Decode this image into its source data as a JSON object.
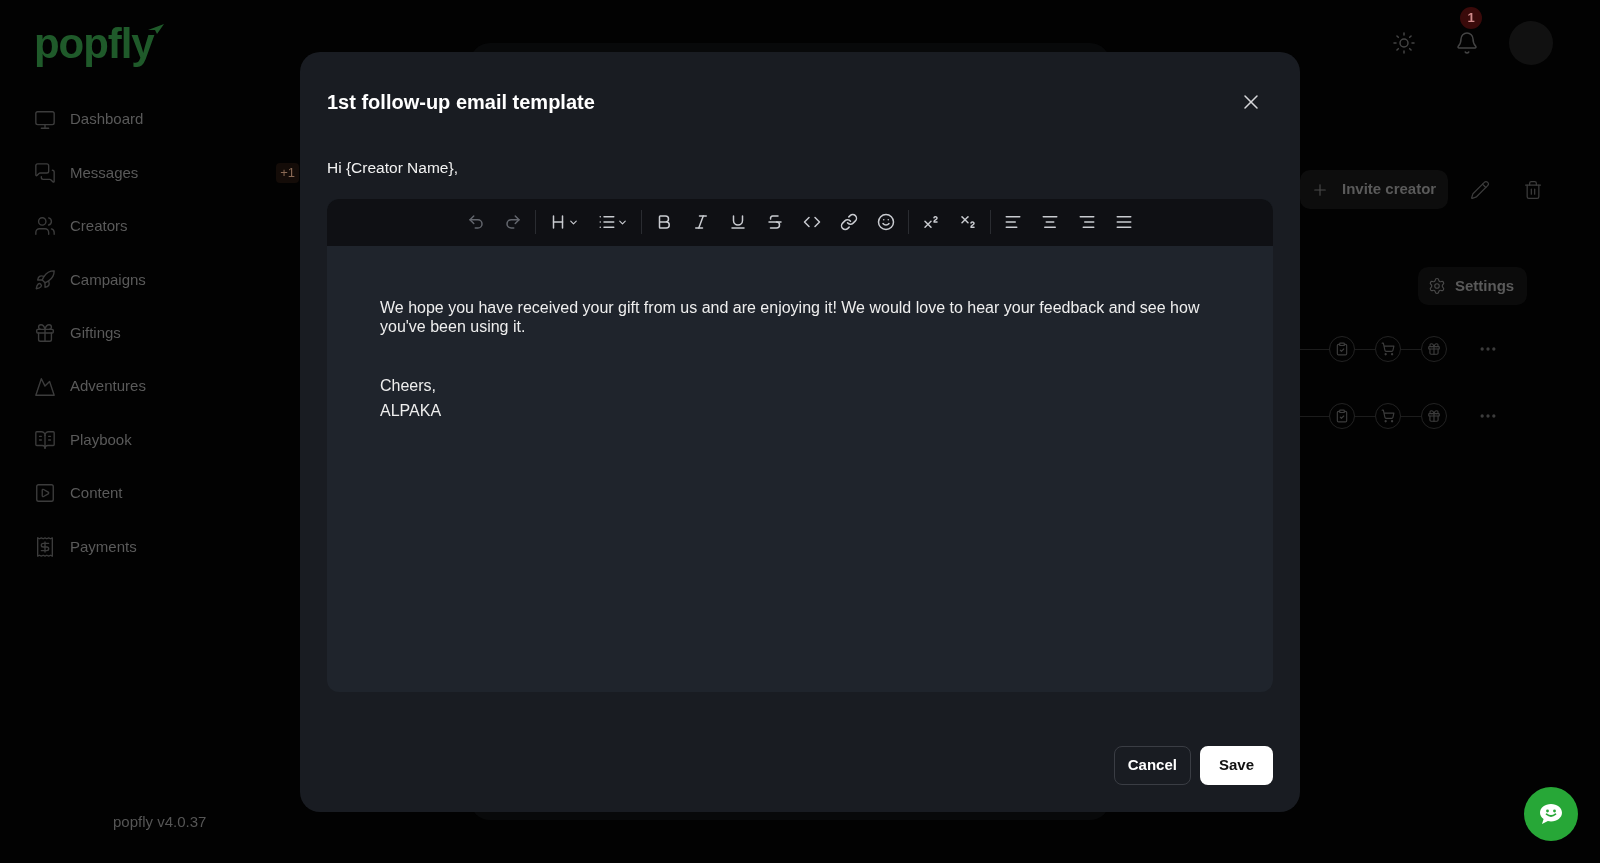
{
  "sidebar": {
    "logo": "popfly",
    "items": [
      {
        "label": "Dashboard"
      },
      {
        "label": "Messages",
        "badge": "+1"
      },
      {
        "label": "Creators"
      },
      {
        "label": "Campaigns"
      },
      {
        "label": "Giftings"
      },
      {
        "label": "Adventures"
      },
      {
        "label": "Playbook"
      },
      {
        "label": "Content"
      },
      {
        "label": "Payments"
      }
    ],
    "version": "popfly v4.0.37"
  },
  "header": {
    "notifications_badge": "1"
  },
  "actions": {
    "invite_button": "Invite creator",
    "settings_button": "Settings"
  },
  "modal": {
    "title": "1st follow-up email template",
    "greeting": "Hi {Creator Name},",
    "toolbar": {
      "groups": [
        {
          "tools": [
            {
              "kind": "undo",
              "disabled": true
            },
            {
              "kind": "redo",
              "disabled": true
            }
          ]
        },
        {
          "tools": [
            {
              "kind": "heading",
              "disabled": false
            },
            {
              "kind": "list",
              "disabled": false
            }
          ]
        },
        {
          "tools": [
            {
              "kind": "bold",
              "disabled": false
            },
            {
              "kind": "italic",
              "disabled": false
            },
            {
              "kind": "underline",
              "disabled": false
            },
            {
              "kind": "strikethrough",
              "disabled": false
            },
            {
              "kind": "code",
              "disabled": false
            },
            {
              "kind": "link",
              "disabled": false
            },
            {
              "kind": "emoji",
              "disabled": false
            }
          ]
        },
        {
          "tools": [
            {
              "kind": "superscript",
              "disabled": false
            },
            {
              "kind": "subscript",
              "disabled": false
            }
          ]
        },
        {
          "tools": [
            {
              "kind": "align_left",
              "disabled": false
            },
            {
              "kind": "align_center",
              "disabled": false
            },
            {
              "kind": "align_right",
              "disabled": false
            },
            {
              "kind": "justify",
              "disabled": false
            }
          ]
        }
      ]
    },
    "body": {
      "paragraphs": [
        "We hope you have received your gift from us and are enjoying it! We would love to hear your feedback and see how you've been using it."
      ],
      "signature": [
        "Cheers,",
        "ALPAKA"
      ]
    },
    "buttons": [
      {
        "label": "Cancel",
        "kind": "secondary"
      },
      {
        "label": "Save",
        "kind": "primary"
      }
    ]
  }
}
